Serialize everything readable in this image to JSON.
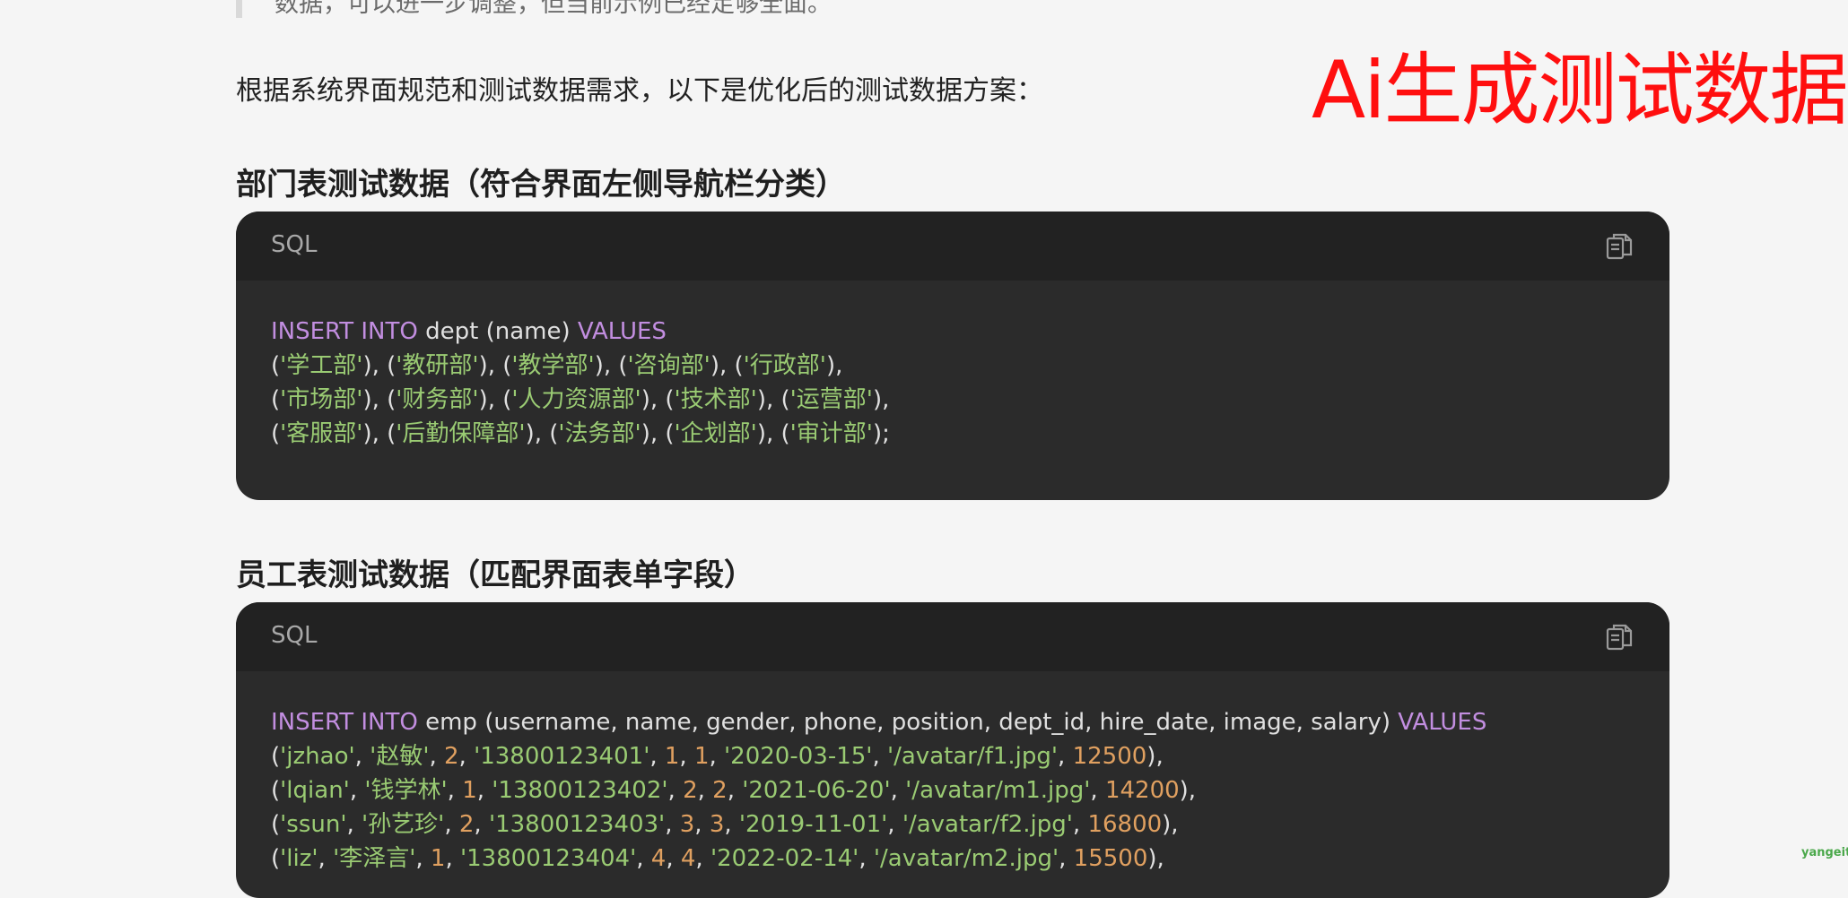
{
  "quote": {
    "text": "数据，可以进一步调整，但当前示例已经足够全面。"
  },
  "intro": "根据系统界面规范和测试数据需求，以下是优化后的测试数据方案：",
  "watermark": "Ai生成测试数据",
  "sections": [
    {
      "heading": "部门表测试数据（符合界面左侧导航栏分类）",
      "code_lang": "SQL",
      "code_lines": [
        "INSERT INTO dept (name) VALUES",
        "('学工部'), ('教研部'), ('教学部'), ('咨询部'), ('行政部'),",
        "('市场部'), ('财务部'), ('人力资源部'), ('技术部'), ('运营部'),",
        "('客服部'), ('后勤保障部'), ('法务部'), ('企划部'), ('审计部');"
      ]
    },
    {
      "heading": "员工表测试数据（匹配界面表单字段）",
      "code_lang": "SQL",
      "code_lines": [
        "INSERT INTO emp (username, name, gender, phone, position, dept_id, hire_date, image, salary) VALUES",
        "('jzhao', '赵敏', 2, '13800123401', 1, 1, '2020-03-15', '/avatar/f1.jpg', 12500),",
        "('lqian', '钱学林', 1, '13800123402', 2, 2, '2021-06-20', '/avatar/m1.jpg', 14200),",
        "('ssun', '孙艺珍', 2, '13800123403', 3, 3, '2019-11-01', '/avatar/f2.jpg', 16800),",
        "('liz', '李泽言', 1, '13800123404', 4, 4, '2022-02-14', '/avatar/m2.jpg', 15500),"
      ]
    }
  ],
  "corner_mark": "yangeit",
  "colors": {
    "keyword": "#c28ee0",
    "string": "#9acb73",
    "number": "#e0a060",
    "watermark": "#ff0f0f"
  },
  "icons": {
    "copy": "copy-icon"
  }
}
